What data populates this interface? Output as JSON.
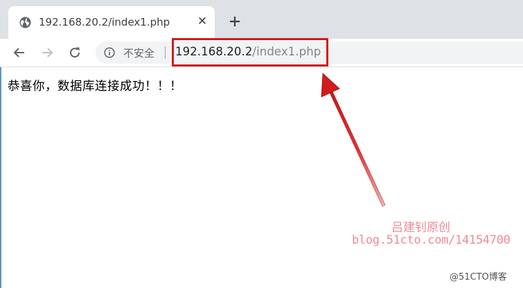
{
  "browser": {
    "tab": {
      "title": "192.168.20.2/index1.php",
      "close_glyph": "✕",
      "favicon": "globe-icon"
    },
    "new_tab_icon": "plus-icon",
    "toolbar": {
      "back_icon": "back-arrow-icon",
      "forward_icon": "forward-arrow-icon",
      "reload_icon": "reload-icon"
    },
    "omnibox": {
      "security_label": "不安全",
      "url_host": "192.168.20.2",
      "url_path": "/index1.php"
    }
  },
  "page": {
    "message": "恭喜你，数据库连接成功！！！"
  },
  "annotation": {
    "highlight_color": "#d01c1c",
    "arrow_color": "#d01c1c"
  },
  "watermark": {
    "author": "吕建钊原创",
    "url": "blog.51cto.com/14154700",
    "brand": "@51CTO博客"
  }
}
